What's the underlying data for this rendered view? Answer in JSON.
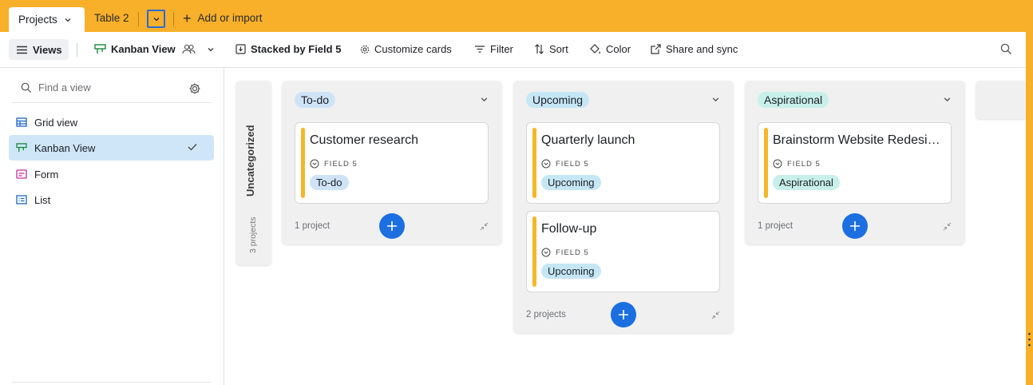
{
  "tabs": {
    "active": "Projects",
    "second": "Table 2",
    "add_import": "Add or import"
  },
  "toolbar": {
    "views": "Views",
    "kanban": "Kanban View",
    "stacked": "Stacked by Field 5",
    "customize": "Customize cards",
    "filter": "Filter",
    "sort": "Sort",
    "color": "Color",
    "share": "Share and sync"
  },
  "sidebar": {
    "find_placeholder": "Find a view",
    "items": [
      {
        "label": "Grid view",
        "icon": "grid-icon"
      },
      {
        "label": "Kanban View",
        "icon": "kanban-icon",
        "active": true
      },
      {
        "label": "Form",
        "icon": "form-icon"
      },
      {
        "label": "List",
        "icon": "list-icon"
      }
    ]
  },
  "board": {
    "uncategorized": {
      "title": "Uncategorized",
      "count": "3 projects"
    },
    "columns": [
      {
        "name": "To-do",
        "color": "#cfe3f7",
        "count": "1 project",
        "cards": [
          {
            "title": "Customer research",
            "field": "FIELD 5",
            "value": "To-do",
            "pill_color": "#cfe3f7"
          }
        ]
      },
      {
        "name": "Upcoming",
        "color": "#c5e6f5",
        "count": "2 projects",
        "cards": [
          {
            "title": "Quarterly launch",
            "field": "FIELD 5",
            "value": "Upcoming",
            "pill_color": "#c5e6f5"
          },
          {
            "title": "Follow-up",
            "field": "FIELD 5",
            "value": "Upcoming",
            "pill_color": "#c5e6f5"
          }
        ]
      },
      {
        "name": "Aspirational",
        "color": "#c8f0ea",
        "count": "1 project",
        "cards": [
          {
            "title": "Brainstorm Website Redesign",
            "field": "FIELD 5",
            "value": "Aspirational",
            "pill_color": "#c8f0ea"
          }
        ]
      }
    ]
  },
  "colors": {
    "accent": "#f8b02a",
    "add_button": "#1b6fe0",
    "card_bar": "#f5b628"
  }
}
